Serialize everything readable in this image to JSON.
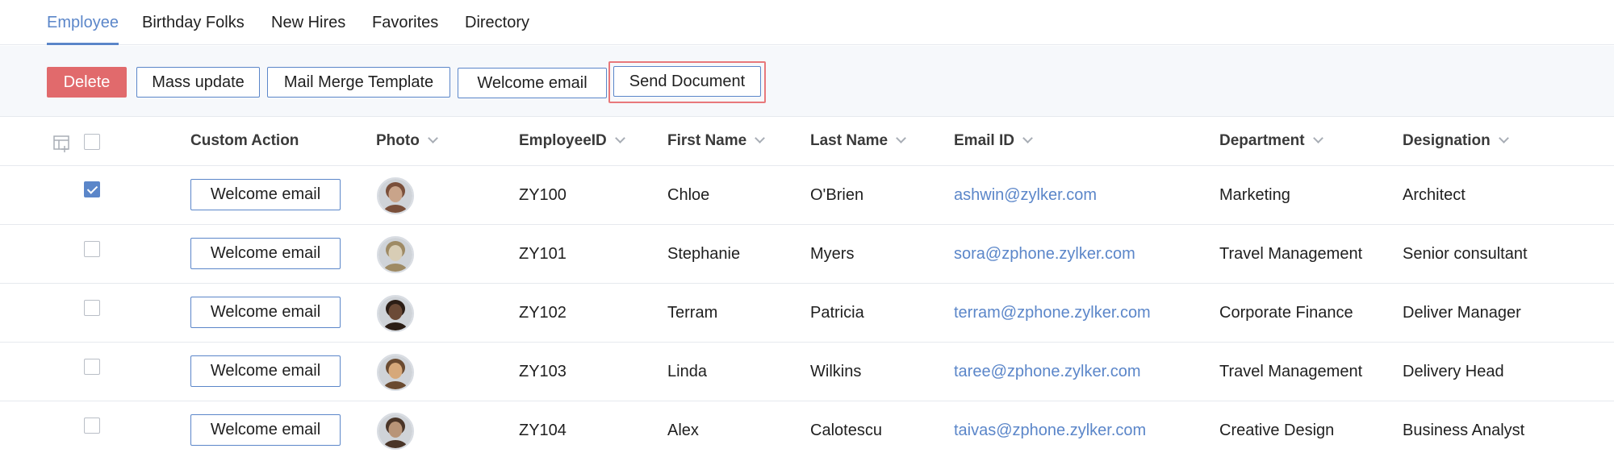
{
  "tabs": [
    {
      "label": "Employee",
      "active": true
    },
    {
      "label": "Birthday Folks",
      "active": false
    },
    {
      "label": "New Hires",
      "active": false
    },
    {
      "label": "Favorites",
      "active": false
    },
    {
      "label": "Directory",
      "active": false
    }
  ],
  "toolbar": {
    "delete_label": "Delete",
    "mass_update_label": "Mass update",
    "mail_merge_label": "Mail Merge Template",
    "welcome_email_label": "Welcome email",
    "send_document_label": "Send Document"
  },
  "columns": {
    "custom_action": "Custom Action",
    "photo": "Photo",
    "employee_id": "EmployeeID",
    "first_name": "First Name",
    "last_name": "Last Name",
    "email": "Email ID",
    "department": "Department",
    "designation": "Designation"
  },
  "row_action_label": "Welcome email",
  "rows": [
    {
      "checked": true,
      "employee_id": "ZY100",
      "first_name": "Chloe",
      "last_name": "O'Brien",
      "email": "ashwin@zylker.com",
      "department": "Marketing",
      "designation": "Architect",
      "avatar_colors": [
        "#c9a48a",
        "#7a4f3a"
      ]
    },
    {
      "checked": false,
      "employee_id": "ZY101",
      "first_name": "Stephanie",
      "last_name": "Myers",
      "email": "sora@zphone.zylker.com",
      "department": "Travel Management",
      "designation": "Senior consultant",
      "avatar_colors": [
        "#d8cdb5",
        "#9e8a64"
      ]
    },
    {
      "checked": false,
      "employee_id": "ZY102",
      "first_name": "Terram",
      "last_name": "Patricia",
      "email": "terram@zphone.zylker.com",
      "department": "Corporate Finance",
      "designation": "Deliver Manager",
      "avatar_colors": [
        "#6b4a36",
        "#2b1d15"
      ]
    },
    {
      "checked": false,
      "employee_id": "ZY103",
      "first_name": "Linda",
      "last_name": "Wilkins",
      "email": "taree@zphone.zylker.com",
      "department": "Travel Management",
      "designation": "Delivery Head",
      "avatar_colors": [
        "#d6a87a",
        "#6a4a30"
      ]
    },
    {
      "checked": false,
      "employee_id": "ZY104",
      "first_name": "Alex",
      "last_name": "Calotescu",
      "email": "taivas@zphone.zylker.com",
      "department": "Creative Design",
      "designation": "Business Analyst",
      "avatar_colors": [
        "#b89478",
        "#4a3528"
      ]
    }
  ],
  "colors": {
    "accent": "#5b86c9",
    "danger": "#e16a6c",
    "highlight": "#e8787b"
  },
  "icons": {
    "column_settings": "table-columns-icon",
    "sort": "chevron-down-icon"
  }
}
